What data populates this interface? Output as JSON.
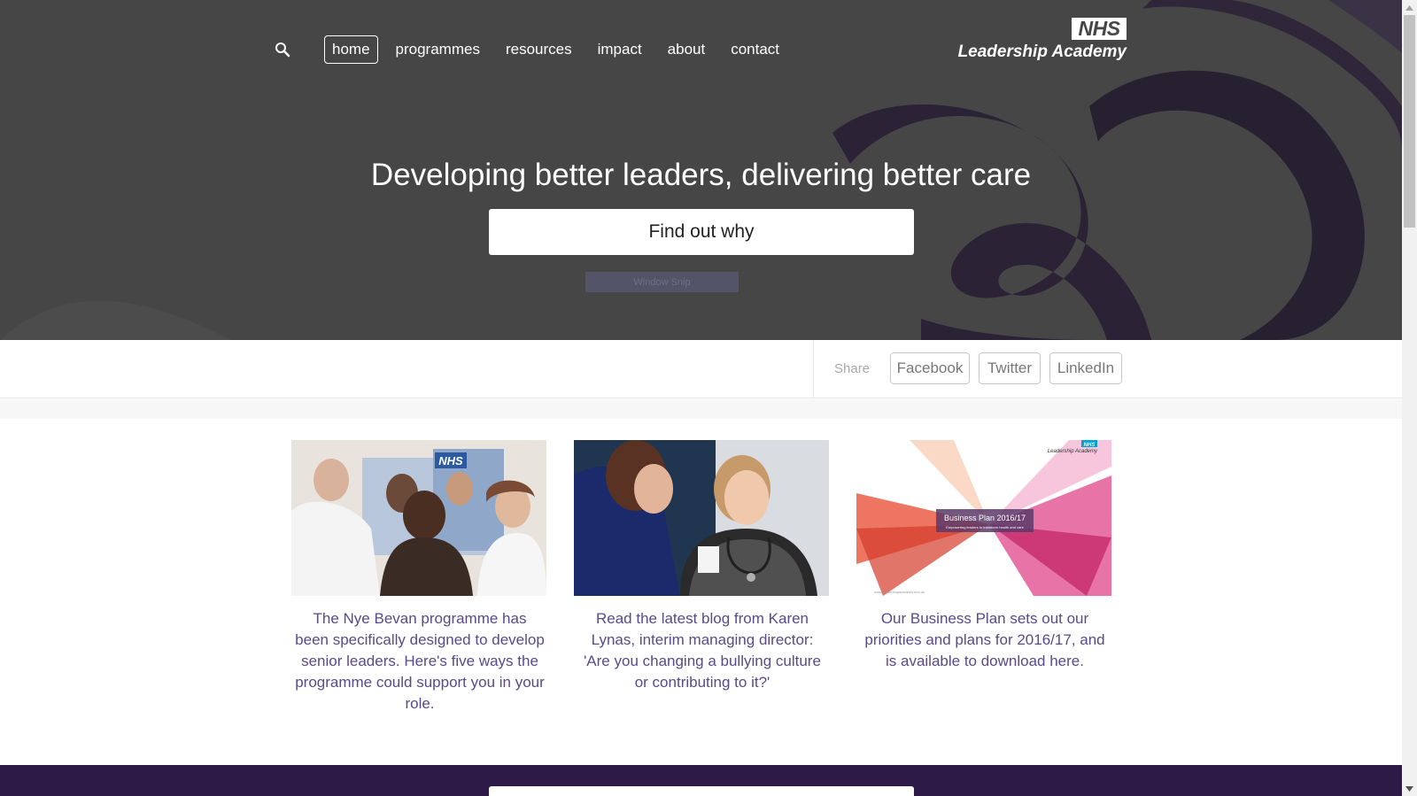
{
  "nav": {
    "items": [
      {
        "label": "home",
        "active": true
      },
      {
        "label": "programmes",
        "active": false
      },
      {
        "label": "resources",
        "active": false
      },
      {
        "label": "impact",
        "active": false
      },
      {
        "label": "about",
        "active": false
      },
      {
        "label": "contact",
        "active": false
      }
    ]
  },
  "logo": {
    "nhs": "NHS",
    "text": "Leadership Academy"
  },
  "hero": {
    "headline": "Developing better leaders, delivering better care",
    "cta_label": "Find out why",
    "overlay_label": "Window Snip"
  },
  "share": {
    "label": "Share",
    "buttons": [
      "Facebook",
      "Twitter",
      "LinkedIn"
    ]
  },
  "cards": [
    {
      "text": "The Nye Bevan programme has been specifically designed to develop senior leaders. Here's five ways the programme could support you in your role.",
      "image_label": "NHS"
    },
    {
      "text": "Read the latest blog from Karen Lynas, interim managing director: 'Are you changing a bullying culture or contributing to it?'"
    },
    {
      "text": "Our Business Plan sets out our priorities and plans for 2016/17, and is available to download here.",
      "image_title": "Business Plan 2016/17",
      "image_subtitle": "Empowering leaders to transform health and care",
      "image_brand_nhs": "NHS",
      "image_brand": "Leadership Academy",
      "image_url": "www.leadershipacademy.nhs.uk"
    }
  ],
  "colors": {
    "hero_bg": "#464646",
    "ribbon": "#2b2236",
    "link_text": "#5a4a8a",
    "footer_band": "#2e1a47"
  },
  "icons": {
    "search": "search-icon",
    "scroll_up": "chevron-up-icon",
    "scroll_down": "chevron-down-icon"
  }
}
